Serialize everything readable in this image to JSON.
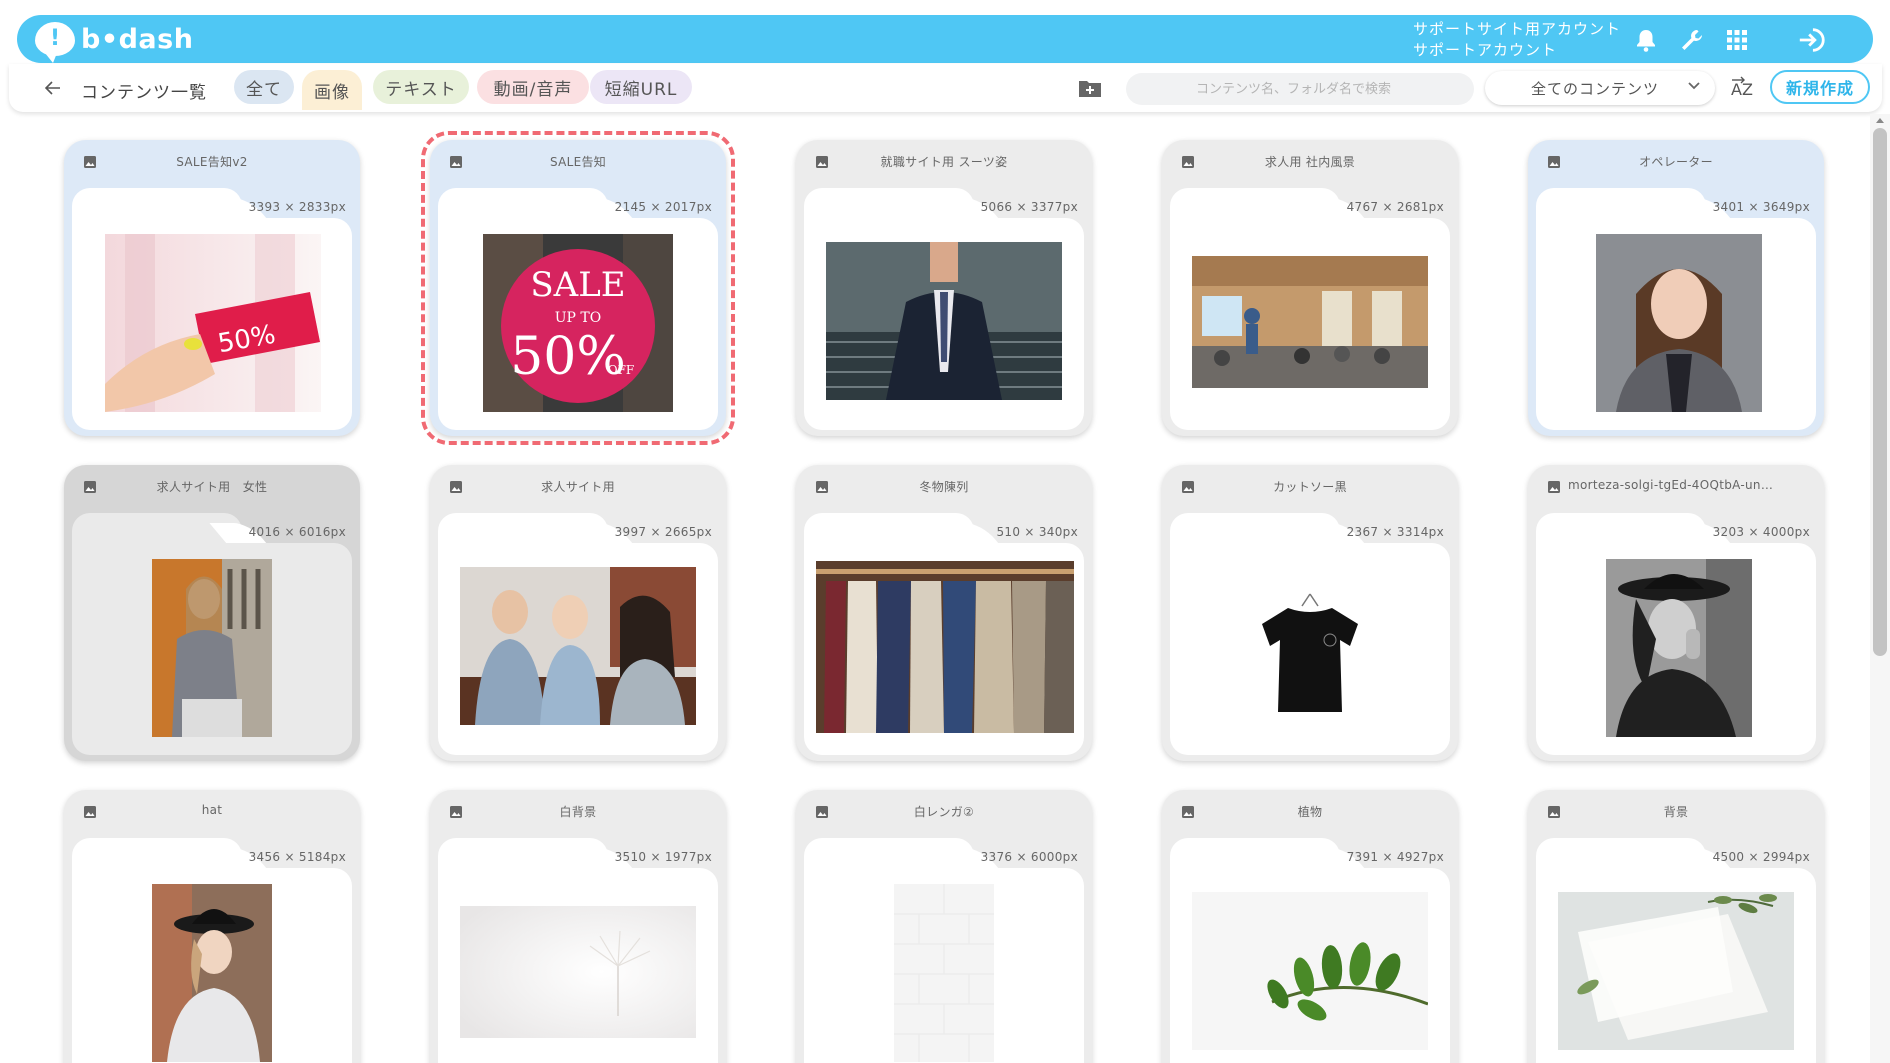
{
  "header": {
    "logo_text": "b•dash",
    "logo_glyph": "!",
    "account_line1": "サポートサイト用アカウント",
    "account_line2": "サポートアカウント",
    "accent_color": "#4fc7f4"
  },
  "toolbar": {
    "breadcrumb": "コンテンツ一覧",
    "filters": [
      {
        "label": "全て",
        "color": "#dbe6f2"
      },
      {
        "label": "画像",
        "color": "#fcefd5"
      },
      {
        "label": "テキスト",
        "color": "#e8f1da"
      },
      {
        "label": "動画/音声",
        "color": "#fbe0e2"
      },
      {
        "label": "短縮URL",
        "color": "#ece6f6"
      }
    ],
    "search_placeholder": "コンテンツ名、フォルダ名で検索",
    "select_value": "全てのコンテンツ",
    "sort_label": "AZ",
    "new_button": "新規作成"
  },
  "cards": [
    {
      "title": "SALE告知v2",
      "dims": "3393 × 2833px"
    },
    {
      "title": "SALE告知",
      "dims": "2145 × 2017px"
    },
    {
      "title": "就職サイト用 スーツ姿",
      "dims": "5066 × 3377px"
    },
    {
      "title": "求人用 社内風景",
      "dims": "4767 × 2681px"
    },
    {
      "title": "オペレーター",
      "dims": "3401 × 3649px"
    },
    {
      "title": "求人サイト用　女性",
      "dims": "4016 × 6016px"
    },
    {
      "title": "求人サイト用",
      "dims": "3997 × 2665px"
    },
    {
      "title": "冬物陳列",
      "dims": "510 × 340px"
    },
    {
      "title": "カットソー黒",
      "dims": "2367 × 3314px"
    },
    {
      "title": "morteza-solgi-tgEd-4OQtbA-un…",
      "dims": "3203 × 4000px"
    },
    {
      "title": "hat",
      "dims": "3456 × 5184px"
    },
    {
      "title": "白背景",
      "dims": "3510 × 1977px"
    },
    {
      "title": "白レンガ②",
      "dims": "3376 × 6000px"
    },
    {
      "title": "植物",
      "dims": "7391 × 4927px"
    },
    {
      "title": "背景",
      "dims": "4500 × 2994px"
    }
  ],
  "sale_image": {
    "line1": "SALE",
    "line2": "UP TO",
    "line3": "50%",
    "line4": "OFF"
  },
  "tag_image": {
    "text": "50%"
  }
}
